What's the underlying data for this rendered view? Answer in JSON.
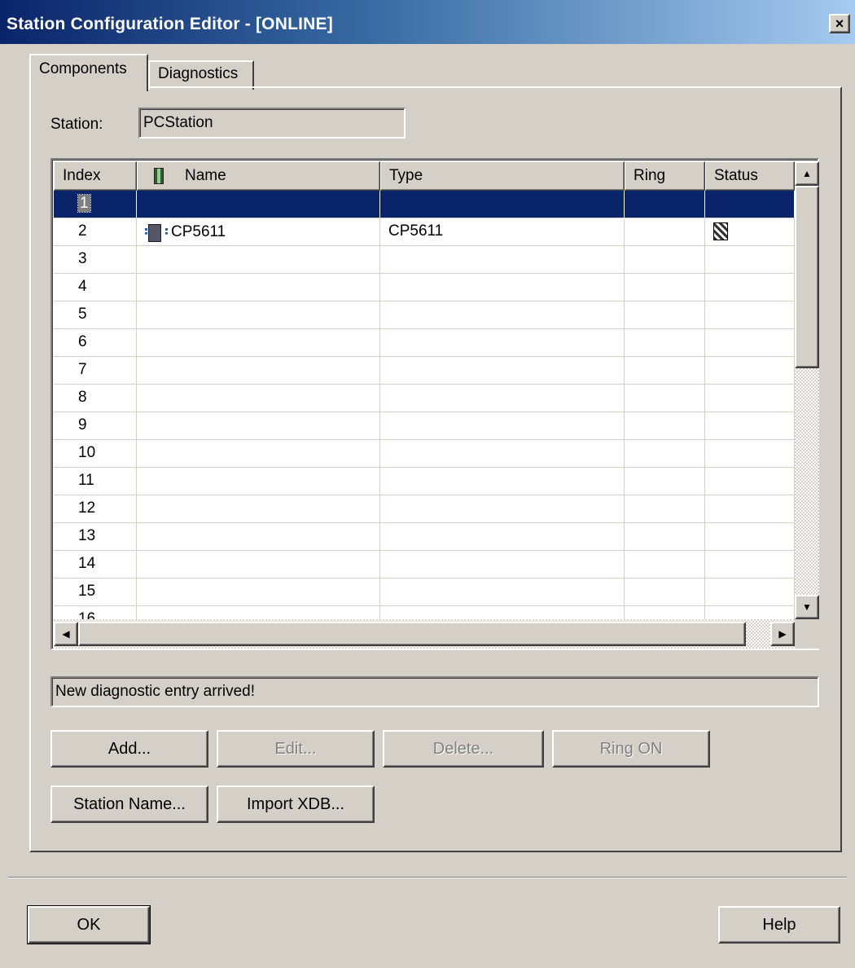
{
  "window": {
    "title": "Station Configuration Editor - [ONLINE]",
    "close_glyph": "×"
  },
  "tabs": [
    {
      "label": "Components",
      "active": true
    },
    {
      "label": "Diagnostics",
      "active": false
    }
  ],
  "station": {
    "label": "Station:",
    "value": "PCStation"
  },
  "grid": {
    "columns": [
      "Index",
      "Name",
      "Type",
      "Ring",
      "Status"
    ],
    "rows": [
      {
        "index": "1",
        "name": "",
        "type": "",
        "ring": "",
        "status": "",
        "selected": true
      },
      {
        "index": "2",
        "name": "CP5611",
        "type": "CP5611",
        "ring": "",
        "status": "status-icon"
      },
      {
        "index": "3"
      },
      {
        "index": "4"
      },
      {
        "index": "5"
      },
      {
        "index": "6"
      },
      {
        "index": "7"
      },
      {
        "index": "8"
      },
      {
        "index": "9"
      },
      {
        "index": "10"
      },
      {
        "index": "11"
      },
      {
        "index": "12"
      },
      {
        "index": "13"
      },
      {
        "index": "14"
      },
      {
        "index": "15"
      },
      {
        "index": "16"
      }
    ]
  },
  "status_message": "New diagnostic entry arrived!",
  "buttons": {
    "add": "Add...",
    "edit": "Edit...",
    "delete": "Delete...",
    "ring_on": "Ring ON",
    "station_name": "Station Name...",
    "import_xdb": "Import XDB...",
    "ok": "OK",
    "help": "Help"
  },
  "colors": {
    "title_bar": "#0a246a",
    "selection": "#0a246a",
    "face": "#d4d0c8"
  }
}
